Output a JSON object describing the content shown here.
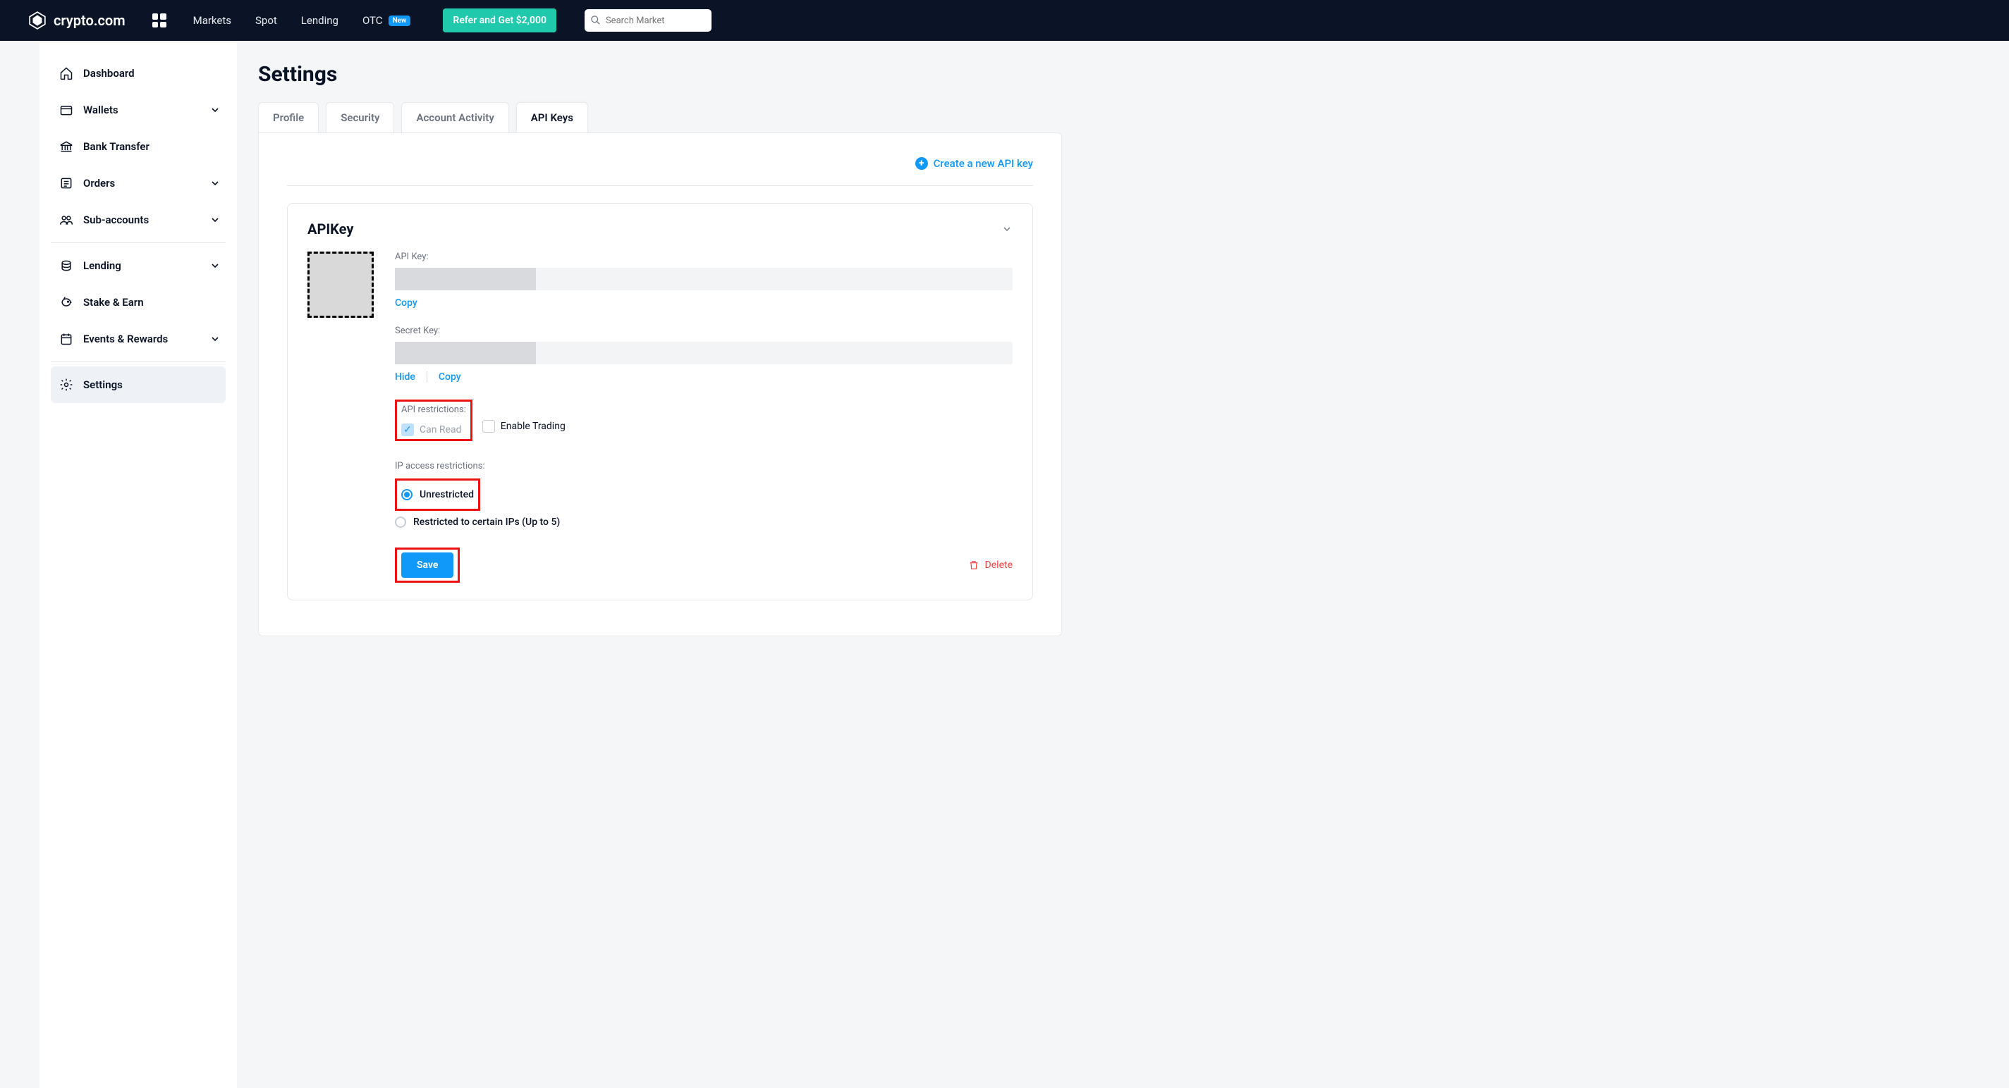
{
  "brand": "crypto.com",
  "nav": {
    "markets": "Markets",
    "spot": "Spot",
    "lending": "Lending",
    "otc": "OTC",
    "otc_badge": "New"
  },
  "refer_btn": "Refer and Get $2,000",
  "search_placeholder": "Search Market",
  "sidebar": {
    "dashboard": "Dashboard",
    "wallets": "Wallets",
    "bank": "Bank Transfer",
    "orders": "Orders",
    "sub": "Sub-accounts",
    "lending": "Lending",
    "stake": "Stake & Earn",
    "events": "Events & Rewards",
    "settings": "Settings"
  },
  "page_title": "Settings",
  "tabs": {
    "profile": "Profile",
    "security": "Security",
    "activity": "Account Activity",
    "api": "API Keys"
  },
  "create_link": "Create a new API key",
  "card": {
    "title": "APIKey",
    "apikey_label": "API Key:",
    "secret_label": "Secret Key:",
    "copy": "Copy",
    "hide": "Hide",
    "restrictions_label": "API restrictions:",
    "can_read": "Can Read",
    "enable_trading": "Enable Trading",
    "ip_label": "IP access restrictions:",
    "unrestricted": "Unrestricted",
    "restricted": "Restricted to certain IPs (Up to 5)",
    "save": "Save",
    "delete": "Delete"
  }
}
